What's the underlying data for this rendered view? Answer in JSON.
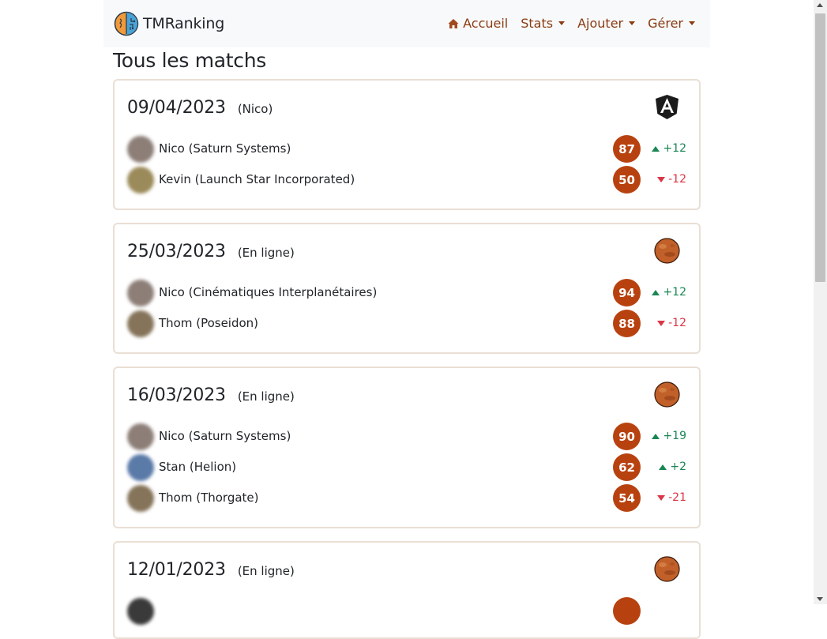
{
  "brand": {
    "name": "TMRanking"
  },
  "nav": {
    "home": "Accueil",
    "stats": "Stats",
    "add": "Ajouter",
    "manage": "Gérer"
  },
  "page": {
    "title": "Tous les matchs"
  },
  "colors": {
    "accent": "#b8420f",
    "positive": "#198754",
    "negative": "#dc3545"
  },
  "matches": [
    {
      "date": "09/04/2023",
      "context": "(Nico)",
      "map_icon": "angular-icon",
      "players": [
        {
          "name": "Nico (Saturn Systems)",
          "score": "87",
          "delta": "+12",
          "trend": "up",
          "avatar": "#8d7f78"
        },
        {
          "name": "Kevin (Launch Star Incorporated)",
          "score": "50",
          "delta": "-12",
          "trend": "down",
          "avatar": "#9b8a5a"
        }
      ]
    },
    {
      "date": "25/03/2023",
      "context": "(En ligne)",
      "map_icon": "mars-icon",
      "players": [
        {
          "name": "Nico (Cinématiques Interplanétaires)",
          "score": "94",
          "delta": "+12",
          "trend": "up",
          "avatar": "#8d7f78"
        },
        {
          "name": "Thom (Poseidon)",
          "score": "88",
          "delta": "-12",
          "trend": "down",
          "avatar": "#85745a"
        }
      ]
    },
    {
      "date": "16/03/2023",
      "context": "(En ligne)",
      "map_icon": "mars-icon",
      "players": [
        {
          "name": "Nico (Saturn Systems)",
          "score": "90",
          "delta": "+19",
          "trend": "up",
          "avatar": "#8d7f78"
        },
        {
          "name": "Stan (Helion)",
          "score": "62",
          "delta": "+2",
          "trend": "up",
          "avatar": "#5a7aa8"
        },
        {
          "name": "Thom (Thorgate)",
          "score": "54",
          "delta": "-21",
          "trend": "down",
          "avatar": "#85745a"
        }
      ]
    },
    {
      "date": "12/01/2023",
      "context": "(En ligne)",
      "map_icon": "mars-icon",
      "players": [
        {
          "name": "",
          "score": "",
          "delta": "",
          "trend": "up",
          "avatar": "#3a3a3a"
        }
      ]
    }
  ]
}
